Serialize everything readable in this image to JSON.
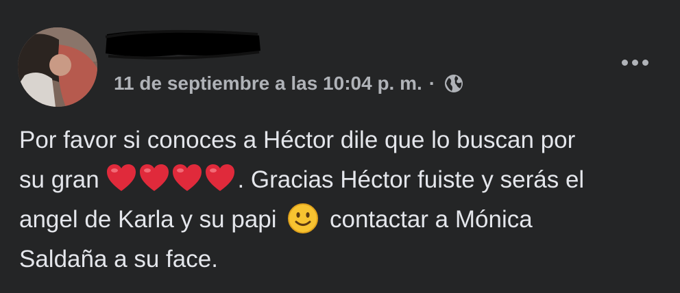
{
  "post": {
    "timestamp": "11 de septiembre a las 10:04 p. m.",
    "separator": "·",
    "privacy_icon": "globe-icon",
    "more_icon": "more-options-icon",
    "text": {
      "line1": "Por favor si conoces a Héctor dile que lo buscan por",
      "line2_before": "su gran ",
      "line2_after": ". Gracias Héctor fuiste y serás el",
      "line3_before": "angel de Karla y su papi ",
      "line3_after": " contactar a Mónica",
      "line4": "Saldaña a su face."
    },
    "emojis": {
      "hearts": [
        "red-heart-icon",
        "red-heart-icon",
        "red-heart-icon",
        "red-heart-icon"
      ],
      "smile": "slightly-smiling-face-icon"
    }
  },
  "colors": {
    "background": "#242526",
    "primary_text": "#e4e6eb",
    "secondary_text": "#b0b3b8",
    "heart": "#e02a3b",
    "smile": "#f7c331"
  }
}
